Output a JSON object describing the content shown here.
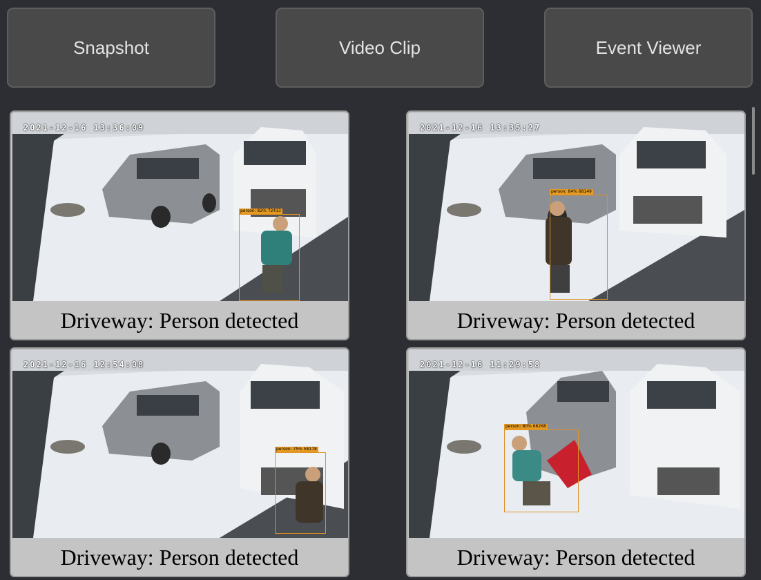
{
  "toolbar": {
    "snapshot_label": "Snapshot",
    "video_clip_label": "Video Clip",
    "event_viewer_label": "Event Viewer"
  },
  "events": [
    {
      "timestamp": "2021-12-16 13:36:09",
      "caption": "Driveway: Person detected",
      "detection_label": "person: 82% 72413"
    },
    {
      "timestamp": "2021-12-16 13:35:27",
      "caption": "Driveway: Person detected",
      "detection_label": "person: 84% 68149"
    },
    {
      "timestamp": "2021-12-16 12:54:08",
      "caption": "Driveway: Person detected",
      "detection_label": "person: 75% 58178"
    },
    {
      "timestamp": "2021-12-16 11:29:58",
      "caption": "Driveway: Person detected",
      "detection_label": "person: 80% 66268"
    }
  ],
  "colors": {
    "page_bg": "#2c2e33",
    "button_bg": "#494949",
    "card_bg": "#c4c4c4",
    "detection_box": "#e09024"
  }
}
